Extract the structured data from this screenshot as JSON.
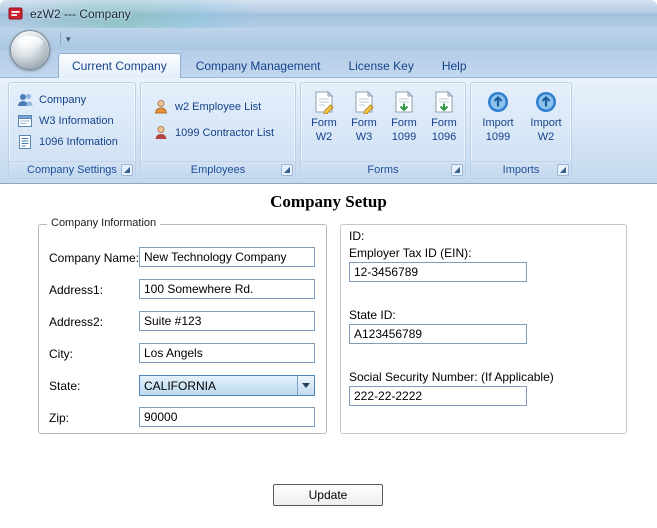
{
  "window": {
    "title": "ezW2 --- Company"
  },
  "colors": {
    "ribbon_text": "#15428b",
    "app_logo_red": "#cf2030",
    "aero_blue": "#b6cee6"
  },
  "tabs": [
    {
      "label": "Current Company"
    },
    {
      "label": "Company Management"
    },
    {
      "label": "License Key"
    },
    {
      "label": "Help"
    }
  ],
  "ribbon": {
    "company_settings": {
      "label": "Company Settings",
      "items": [
        {
          "label": "Company",
          "icon": "company-icon"
        },
        {
          "label": "W3 Information",
          "icon": "w3-information-icon"
        },
        {
          "label": "1096 Infomation",
          "icon": "1096-information-icon"
        }
      ]
    },
    "employees": {
      "label": "Employees",
      "items": [
        {
          "label": "w2 Employee List",
          "icon": "employee-list-icon"
        },
        {
          "label": "1099 Contractor List",
          "icon": "contractor-list-icon"
        }
      ]
    },
    "forms": {
      "label": "Forms",
      "items": [
        {
          "label": "Form W2",
          "icon": "form-w2-icon"
        },
        {
          "label": "Form W3",
          "icon": "form-w3-icon"
        },
        {
          "label": "Form 1099",
          "icon": "form-1099-icon"
        },
        {
          "label": "Form 1096",
          "icon": "form-1096-icon"
        }
      ]
    },
    "imports": {
      "label": "Imports",
      "items": [
        {
          "label": "Import 1099",
          "icon": "import-1099-icon"
        },
        {
          "label": "Import W2",
          "icon": "import-w2-icon"
        }
      ]
    }
  },
  "main": {
    "title": "Company Setup",
    "company_info": {
      "legend": "Company Information",
      "fields": [
        {
          "label": "Company Name:",
          "value": "New Technology Company"
        },
        {
          "label": "Address1:",
          "value": "100 Somewhere Rd."
        },
        {
          "label": "Address2:",
          "value": "Suite #123"
        },
        {
          "label": "City:",
          "value": "Los Angels"
        },
        {
          "label": "State:",
          "value": "CALIFORNIA"
        },
        {
          "label": "Zip:",
          "value": "90000"
        }
      ]
    },
    "id_section": {
      "heading": "ID:",
      "fields": [
        {
          "label": "Employer Tax ID (EIN):",
          "value": "12-3456789"
        },
        {
          "label": "State ID:",
          "value": "A123456789"
        },
        {
          "label": "Social Security Number: (If Applicable)",
          "value": "222-22-2222"
        }
      ]
    },
    "update_button": "Update"
  }
}
